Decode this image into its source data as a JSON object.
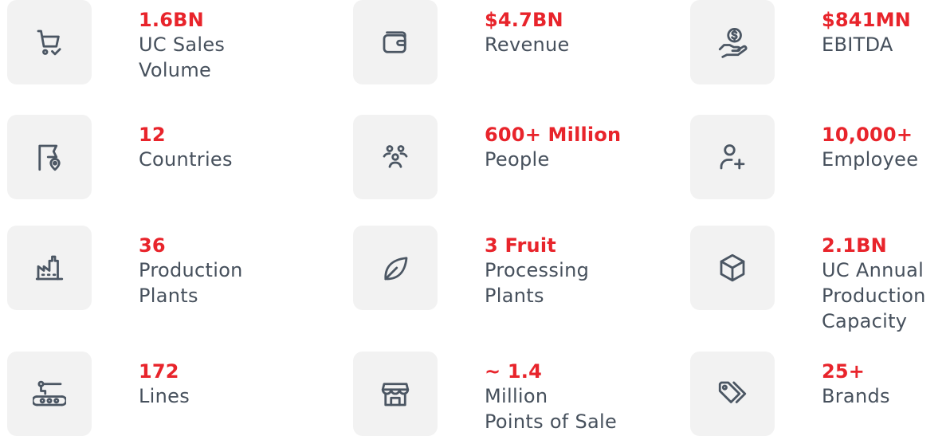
{
  "stats": [
    {
      "value": "1.6BN",
      "label": "UC Sales\nVolume",
      "icon": "shopping-cart-check-icon"
    },
    {
      "value": "$4.7BN",
      "label": "Revenue",
      "icon": "wallet-icon"
    },
    {
      "value": "$841MN",
      "label": "EBITDA",
      "icon": "hand-coin-icon"
    },
    {
      "value": "12",
      "label": "Countries",
      "icon": "flag-location-icon"
    },
    {
      "value": "600+ Million",
      "label": "People",
      "icon": "people-group-icon"
    },
    {
      "value": "10,000+",
      "label": "Employee",
      "icon": "user-add-icon"
    },
    {
      "value": "36",
      "label": "Production\nPlants",
      "icon": "factory-icon"
    },
    {
      "value": "3 Fruit",
      "label": "Processing\nPlants",
      "icon": "leaf-icon"
    },
    {
      "value": "2.1BN",
      "label": "UC Annual\nProduction\nCapacity",
      "icon": "box-icon"
    },
    {
      "value": "172",
      "label": "Lines",
      "icon": "conveyor-belt-icon"
    },
    {
      "value": "~ 1.4",
      "label": "Million\nPoints of Sale",
      "icon": "store-icon"
    },
    {
      "value": "25+",
      "label": "Brands",
      "icon": "price-tags-icon"
    }
  ],
  "colors": {
    "value": "#e8242b",
    "label": "#46505c",
    "tile": "#f2f2f2",
    "icon": "#4b5663"
  }
}
